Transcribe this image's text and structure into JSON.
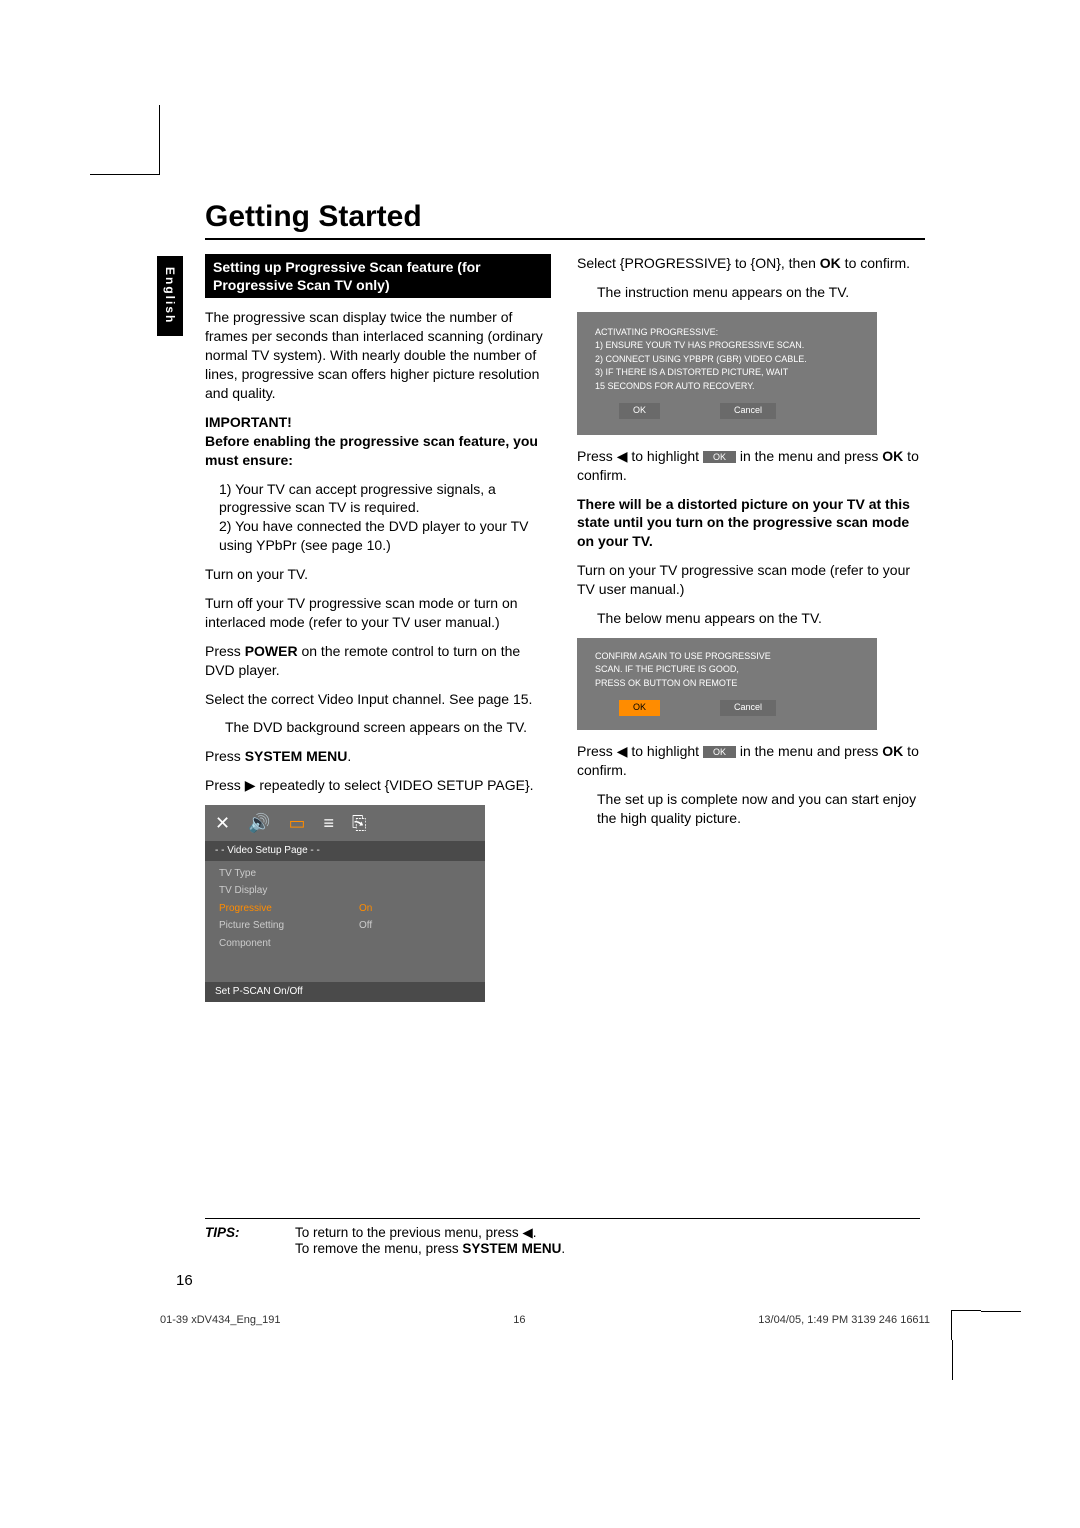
{
  "lang": "English",
  "title": "Getting Started",
  "section_header": "Setting up Progressive Scan feature (for Progressive Scan TV only)",
  "left": {
    "intro": "The progressive scan display twice the number of frames per seconds than interlaced scanning (ordinary normal TV system). With nearly double the number of lines, progressive scan offers higher picture resolution and quality.",
    "important": "IMPORTANT!",
    "before": "Before enabling the progressive scan feature, you must ensure:",
    "li1": "1) Your TV can accept progressive signals, a progressive scan TV is required.",
    "li2": "2) You have connected the DVD player to your TV using YPbPr (see page 10.)",
    "turn_on_tv": "Turn on your TV.",
    "turn_off": "Turn off your TV progressive scan mode or turn on interlaced mode (refer to your TV user manual.)",
    "press_power_a": "Press ",
    "press_power_b": "POWER",
    "press_power_c": " on the remote control to turn on the DVD player.",
    "select_input": "Select the correct Video Input channel. See page 15.",
    "dvd_bg": "The DVD background screen appears on the TV.",
    "press_sysmenu_a": "Press ",
    "press_sysmenu_b": "SYSTEM MENU",
    "press_sysmenu_c": ".",
    "press_right_a": "Press ",
    "press_right_b": " repeatedly to select {VIDEO SETUP PAGE}."
  },
  "video_menu": {
    "header": "- -   Video Setup Page   - -",
    "rows": [
      {
        "label": "TV Type",
        "value": ""
      },
      {
        "label": "TV Display",
        "value": ""
      },
      {
        "label": "Progressive",
        "value": "On",
        "hl": true
      },
      {
        "label": "Picture Setting",
        "value": "Off"
      },
      {
        "label": "Component",
        "value": ""
      }
    ],
    "footer": "Set P-SCAN On/Off"
  },
  "right": {
    "select_prog_a": "Select {PROGRESSIVE} to {ON}, then ",
    "select_prog_b": "OK",
    "select_prog_c": " to confirm.",
    "instr_menu": "The instruction menu appears on the TV.",
    "dialog1": {
      "l1": "ACTIVATING PROGRESSIVE:",
      "l2": "1) ENSURE YOUR TV HAS PROGRESSIVE SCAN.",
      "l3": "2) CONNECT USING YPBPR (GBR) VIDEO CABLE.",
      "l4": "3) IF THERE IS A DISTORTED PICTURE, WAIT",
      "l5": "    15 SECONDS FOR AUTO RECOVERY.",
      "ok": "OK",
      "cancel": "Cancel"
    },
    "press_left1_a": "Press ",
    "press_left1_b": " to highlight ",
    "press_left1_c": " in the menu and press ",
    "press_left1_ok": "OK",
    "press_left1_d": " to confirm.",
    "distorted": "There will be a distorted picture on your TV at this state until you turn on the progressive scan mode on your TV.",
    "turn_on_prog": "Turn on your TV progressive scan mode (refer to your TV user manual.)",
    "below_menu": "The below menu appears on the TV.",
    "dialog2": {
      "l1": "CONFIRM AGAIN TO USE PROGRESSIVE",
      "l2": "SCAN.  IF THE PICTURE IS GOOD,",
      "l3": "PRESS OK BUTTON ON REMOTE",
      "ok": "OK",
      "cancel": "Cancel"
    },
    "press_left2_a": "Press ",
    "press_left2_b": " to highlight ",
    "press_left2_c": " in the menu and press ",
    "press_left2_ok": "OK",
    "press_left2_d": " to confirm.",
    "complete": "The set up is complete now and you can start enjoy the high quality picture."
  },
  "tips": {
    "label": "TIPS:",
    "l1_a": "To return to the previous menu, press ",
    "l1_b": ".",
    "l2_a": "To remove the menu, press ",
    "l2_b": "SYSTEM MENU",
    "l2_c": "."
  },
  "inline_ok": "OK",
  "page_number": "16",
  "footer": {
    "left": "01-39 xDV434_Eng_191",
    "center": "16",
    "right_a": "13/04/05, 1:49 PM",
    "right_b": "3139 246 16611"
  },
  "arrows": {
    "left": "◀",
    "right": "▶"
  }
}
